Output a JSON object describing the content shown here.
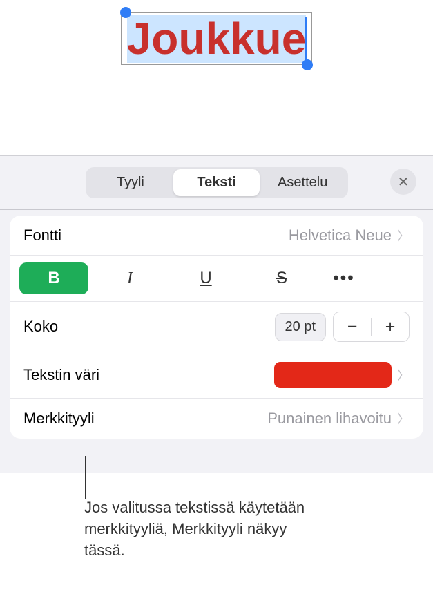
{
  "canvas": {
    "selected_text": "Joukkue"
  },
  "tabs": {
    "style": "Tyyli",
    "text": "Teksti",
    "layout": "Asettelu"
  },
  "font": {
    "label": "Fontti",
    "value": "Helvetica Neue"
  },
  "format_buttons": {
    "bold": "B",
    "italic": "I",
    "underline": "U",
    "strike": "S",
    "more": "•••"
  },
  "size": {
    "label": "Koko",
    "value": "20 pt",
    "minus": "−",
    "plus": "+"
  },
  "text_color": {
    "label": "Tekstin väri",
    "color": "#e32818"
  },
  "char_style": {
    "label": "Merkkityyli",
    "value": "Punainen lihavoitu"
  },
  "callout": {
    "text": "Jos valitussa tekstissä käytetään merkkityyliä, Merkkityyli näkyy tässä."
  }
}
